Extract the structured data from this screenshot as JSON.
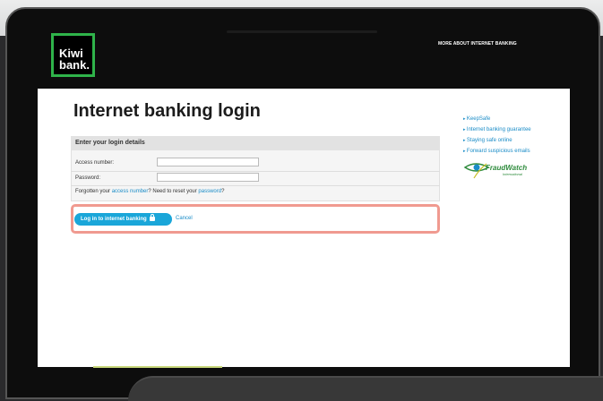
{
  "brand": {
    "logo_text": "Kiwi\nbank."
  },
  "nav": {
    "more_label": "MORE ABOUT INTERNET BANKING"
  },
  "page": {
    "title": "Internet banking login"
  },
  "form": {
    "header": "Enter your login details",
    "access_label": "Access number:",
    "password_label": "Password:",
    "forgot_prefix": "Forgotten your ",
    "forgot_access_link": "access number",
    "forgot_mid": "? Need to reset your ",
    "forgot_password_link": "password",
    "forgot_suffix": "?"
  },
  "actions": {
    "login_label": "Log in to internet banking",
    "cancel_label": "Cancel"
  },
  "sidebar": {
    "links": [
      "KeepSafe",
      "Internet banking guarantee",
      "Staying safe online",
      "Forward suspicious emails"
    ]
  },
  "fraudwatch": {
    "name": "FraudWatch",
    "sub": "International"
  },
  "colors": {
    "brand_green": "#2fb34a",
    "accent_blue": "#1aa6d9",
    "highlight": "#f09a90"
  }
}
